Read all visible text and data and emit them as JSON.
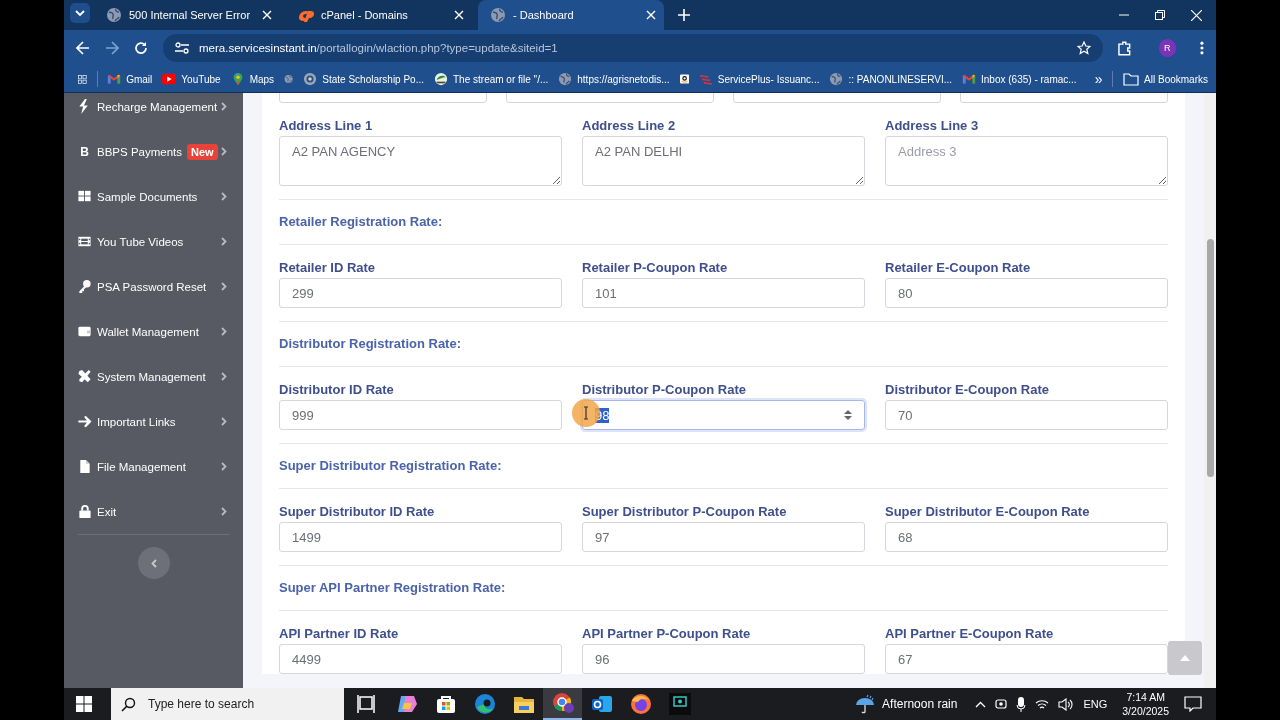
{
  "browser": {
    "tabs": [
      {
        "title": "500 Internal Server Error",
        "kind": "globe",
        "selected": false
      },
      {
        "title": "cPanel - Domains",
        "kind": "cpanel",
        "selected": false
      },
      {
        "title": "- Dashboard",
        "kind": "globe",
        "selected": true
      }
    ],
    "url": {
      "host": "mera.servicesinstant.in",
      "path": "/portallogin/wlaction.php?type=update&siteid=1"
    },
    "profile": "R",
    "bookmarks": [
      {
        "label": "Gmail",
        "kind": "mail"
      },
      {
        "label": "YouTube",
        "kind": "video"
      },
      {
        "label": "Maps",
        "kind": "pin"
      },
      {
        "kind": "globe"
      },
      {
        "label": "State Scholarship Po...",
        "kind": "emblem"
      },
      {
        "label": "The stream or file \"/...",
        "kind": "leaf"
      },
      {
        "label": "https://agrisnetodis...",
        "kind": "globe"
      },
      {
        "kind": "amazon"
      },
      {
        "label": "ServicePlus- Issuanc...",
        "kind": "stripes"
      },
      {
        "label": ":: PANONLINESERVI...",
        "kind": "globe"
      },
      {
        "label": "Inbox (635) - ramac...",
        "kind": "mail"
      }
    ],
    "more": "»",
    "all_bookmarks": "All Bookmarks"
  },
  "sidebar": {
    "items": [
      {
        "label": "Recharge Management",
        "kind": "bolt"
      },
      {
        "label": "BBPS Payments",
        "kind": "letter",
        "icon_text": "B",
        "badge": "New"
      },
      {
        "label": "Sample Documents",
        "kind": "grid"
      },
      {
        "label": "You Tube Videos",
        "kind": "film"
      },
      {
        "label": "PSA Password Reset",
        "kind": "key"
      },
      {
        "label": "Wallet Management",
        "kind": "wallet"
      },
      {
        "label": "System Management",
        "kind": "tools"
      },
      {
        "label": "Important Links",
        "kind": "arrow"
      },
      {
        "label": "File Management",
        "kind": "file"
      },
      {
        "label": "Exit",
        "kind": "lock"
      }
    ]
  },
  "form": {
    "cut_fields": [
      {
        "kind": "input"
      },
      {
        "kind": "input"
      },
      {
        "kind": "input"
      },
      {
        "kind": "input"
      }
    ],
    "address_fields": [
      {
        "label": "Address Line 1",
        "value": "A2 PAN AGENCY"
      },
      {
        "label": "Address Line 2",
        "value": "A2 PAN DELHI"
      },
      {
        "label": "Address Line 3",
        "placeholder": "Address 3"
      }
    ],
    "sections": [
      {
        "heading": "Retailer Registration Rate:",
        "fields": [
          {
            "label": "Retailer ID Rate",
            "value": "299",
            "focused": false
          },
          {
            "label": "Retailer P-Coupon Rate",
            "value": "101",
            "focused": false
          },
          {
            "label": "Retailer E-Coupon Rate",
            "value": "80",
            "focused": false
          }
        ]
      },
      {
        "heading": "Distributor Registration Rate:",
        "fields": [
          {
            "label": "Distributor ID Rate",
            "value": "999",
            "focused": false
          },
          {
            "label": "Distributor P-Coupon Rate",
            "value": "98",
            "focused": true,
            "text_selected": true,
            "click_highlight": true
          },
          {
            "label": "Distributor E-Coupon Rate",
            "value": "70",
            "focused": false
          }
        ]
      },
      {
        "heading": "Super Distributor Registration Rate:",
        "fields": [
          {
            "label": "Super Distributor ID Rate",
            "value": "1499",
            "focused": false
          },
          {
            "label": "Super Distributor P-Coupon Rate",
            "value": "97",
            "focused": false
          },
          {
            "label": "Super Distributor E-Coupon Rate",
            "value": "68",
            "focused": false
          }
        ]
      },
      {
        "heading": "Super API Partner Registration Rate:",
        "fields": [
          {
            "label": "API Partner ID Rate",
            "value": "4499",
            "focused": false
          },
          {
            "label": "API Partner P-Coupon Rate",
            "value": "96",
            "focused": false
          },
          {
            "label": "API Partner E-Coupon Rate",
            "value": "67",
            "focused": false
          }
        ]
      }
    ]
  },
  "taskbar": {
    "search_placeholder": "Type here to search",
    "apps": [
      {
        "kind": "taskview",
        "selected": false
      },
      {
        "kind": "copilot",
        "selected": false
      },
      {
        "kind": "store",
        "selected": false
      },
      {
        "kind": "edge",
        "selected": false
      },
      {
        "kind": "folder",
        "selected": false
      },
      {
        "kind": "chrome",
        "selected": true
      },
      {
        "kind": "outlook",
        "selected": false
      },
      {
        "kind": "firefox",
        "selected": false
      },
      {
        "kind": "recorder",
        "selected": false
      }
    ],
    "weather": "Afternoon rain",
    "language": "ENG",
    "time": "7:14 AM",
    "date": "3/20/2025"
  }
}
